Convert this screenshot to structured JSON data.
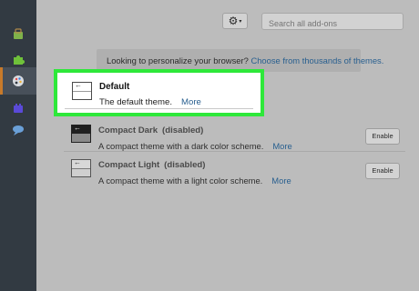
{
  "sidebar": {
    "items": [
      {
        "icon": "extensions-bag-icon"
      },
      {
        "icon": "puzzle-plugins-icon"
      },
      {
        "icon": "palette-appearance-icon",
        "active": true
      },
      {
        "icon": "plugins-lego-icon"
      },
      {
        "icon": "speech-bubble-services-icon"
      }
    ]
  },
  "toolbar": {
    "gear_icon": "⚙",
    "caret": "▾",
    "search_placeholder": "Search all add-ons"
  },
  "banner": {
    "text": "Looking to personalize your browser?",
    "link": "Choose from thousands of themes."
  },
  "themes": [
    {
      "name": "Default",
      "description": "The default theme.",
      "more": "More"
    },
    {
      "name": "Compact Dark",
      "status": "(disabled)",
      "description": "A compact theme with a dark color scheme.",
      "more": "More",
      "button": "Enable"
    },
    {
      "name": "Compact Light",
      "status": "(disabled)",
      "description": "A compact theme with a light color scheme.",
      "more": "More",
      "button": "Enable"
    }
  ],
  "colors": {
    "highlight": "#2ee83a",
    "link": "#285f8f",
    "sidebar_bg": "#323a42",
    "active_accent": "#c87a2a"
  }
}
